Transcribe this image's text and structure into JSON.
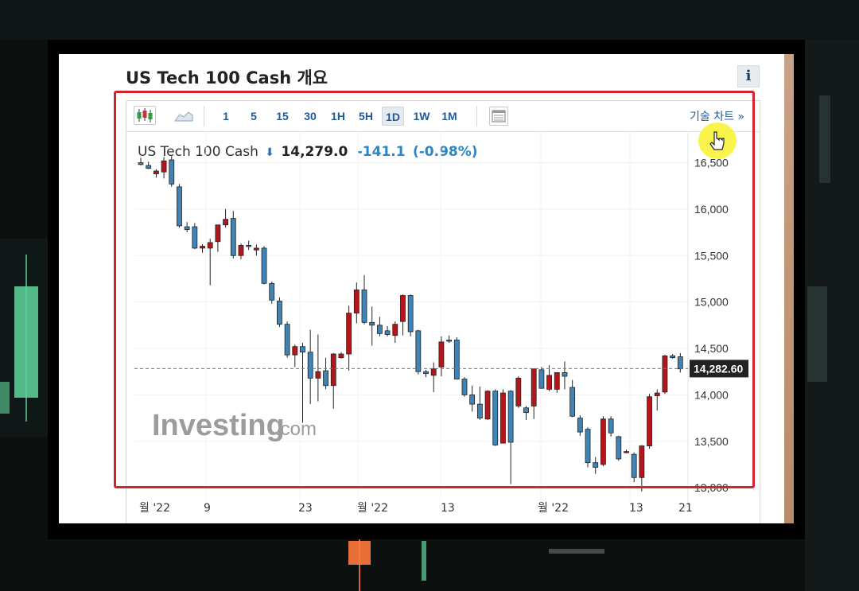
{
  "page": {
    "title": "US Tech 100 Cash 개요",
    "info_label": "i"
  },
  "toolbar": {
    "timeframes": [
      {
        "label": "1",
        "active": false
      },
      {
        "label": "5",
        "active": false
      },
      {
        "label": "15",
        "active": false
      },
      {
        "label": "30",
        "active": false
      },
      {
        "label": "1H",
        "active": false
      },
      {
        "label": "5H",
        "active": false
      },
      {
        "label": "1D",
        "active": true
      },
      {
        "label": "1W",
        "active": false
      },
      {
        "label": "1M",
        "active": false
      }
    ],
    "tech_chart_link": "기술 차트 »",
    "icons": [
      "candlestick-chart-icon",
      "area-chart-icon",
      "table-view-icon"
    ]
  },
  "quote": {
    "name": "US Tech 100 Cash",
    "direction_icon": "arrow-down-icon",
    "price": "14,279.0",
    "change": "-141.1",
    "change_pct": "(-0.98%)"
  },
  "watermark": {
    "brand": "Investing",
    "suffix": ".com"
  },
  "colors": {
    "up": "#b3171c",
    "down": "#3f84b7",
    "link": "#1f5b9a",
    "highlight_box": "#d3232b"
  },
  "chart_data": {
    "type": "candlestick",
    "ylim": [
      12950,
      16650
    ],
    "y_ticks": [
      "16,500",
      "16,000",
      "15,500",
      "15,000",
      "14,500",
      "14,000",
      "13,500",
      "13,000"
    ],
    "y_tick_values": [
      16500,
      16000,
      15500,
      15000,
      14500,
      14000,
      13500,
      13000
    ],
    "x_ticks": [
      "월 '22",
      "9",
      "23",
      "월 '22",
      "13",
      "월 '22",
      "13",
      "21"
    ],
    "last_price_label": "14,282.60",
    "last_price": 14282.6,
    "candles": [
      [
        16500,
        16550,
        16470,
        16480
      ],
      [
        16470,
        16510,
        16430,
        16440
      ],
      [
        16380,
        16430,
        16340,
        16410
      ],
      [
        16400,
        16560,
        16330,
        16520
      ],
      [
        16530,
        16570,
        16240,
        16270
      ],
      [
        16240,
        16270,
        15800,
        15820
      ],
      [
        15810,
        15860,
        15750,
        15780
      ],
      [
        15810,
        15850,
        15570,
        15580
      ],
      [
        15580,
        15620,
        15530,
        15600
      ],
      [
        15580,
        15680,
        15180,
        15640
      ],
      [
        15650,
        15830,
        15540,
        15830
      ],
      [
        15830,
        16000,
        15800,
        15890
      ],
      [
        15900,
        15980,
        15470,
        15500
      ],
      [
        15500,
        15630,
        15460,
        15610
      ],
      [
        15610,
        15660,
        15560,
        15600
      ],
      [
        15560,
        15620,
        15500,
        15580
      ],
      [
        15580,
        15600,
        15190,
        15200
      ],
      [
        15200,
        15220,
        14980,
        15020
      ],
      [
        15010,
        15050,
        14730,
        14760
      ],
      [
        14760,
        14790,
        14400,
        14430
      ],
      [
        14430,
        14540,
        14300,
        14520
      ],
      [
        14520,
        14560,
        13700,
        14460
      ],
      [
        14460,
        14700,
        13900,
        14180
      ],
      [
        14180,
        14650,
        13930,
        14250
      ],
      [
        14260,
        14400,
        14060,
        14100
      ],
      [
        14100,
        14450,
        13850,
        14440
      ],
      [
        14400,
        14460,
        14390,
        14440
      ],
      [
        14440,
        14960,
        14260,
        14880
      ],
      [
        14880,
        15210,
        14770,
        15130
      ],
      [
        15130,
        15290,
        14760,
        14780
      ],
      [
        14780,
        14950,
        14530,
        14750
      ],
      [
        14750,
        14840,
        14630,
        14660
      ],
      [
        14690,
        14740,
        14630,
        14650
      ],
      [
        14640,
        14790,
        14560,
        14760
      ],
      [
        14790,
        15080,
        14640,
        15070
      ],
      [
        15070,
        15080,
        14630,
        14680
      ],
      [
        14690,
        14700,
        14220,
        14250
      ],
      [
        14250,
        14270,
        14190,
        14230
      ],
      [
        14210,
        14350,
        14030,
        14280
      ],
      [
        14300,
        14630,
        14200,
        14570
      ],
      [
        14590,
        14640,
        14560,
        14580
      ],
      [
        14590,
        14620,
        14170,
        14170
      ],
      [
        14170,
        14190,
        13980,
        14000
      ],
      [
        14000,
        14100,
        13820,
        13900
      ],
      [
        13900,
        14090,
        13730,
        13750
      ],
      [
        13740,
        14050,
        13730,
        14040
      ],
      [
        14040,
        14060,
        13450,
        13460
      ],
      [
        13480,
        14060,
        13480,
        14020
      ],
      [
        14040,
        14050,
        13040,
        13490
      ],
      [
        13880,
        14200,
        13860,
        14180
      ],
      [
        13860,
        13880,
        13730,
        13810
      ],
      [
        13880,
        14270,
        13740,
        14280
      ],
      [
        14270,
        14300,
        14070,
        14070
      ],
      [
        14060,
        14320,
        14040,
        14210
      ],
      [
        14060,
        14240,
        14020,
        14240
      ],
      [
        14240,
        14360,
        14060,
        14200
      ],
      [
        14080,
        14160,
        13760,
        13770
      ],
      [
        13750,
        13780,
        13560,
        13600
      ],
      [
        13630,
        13650,
        13220,
        13270
      ],
      [
        13270,
        13330,
        13150,
        13220
      ],
      [
        13250,
        13770,
        13230,
        13740
      ],
      [
        13740,
        13770,
        13550,
        13590
      ],
      [
        13550,
        13560,
        13290,
        13310
      ],
      [
        13380,
        13410,
        13370,
        13390
      ],
      [
        13360,
        13380,
        13060,
        13110
      ],
      [
        13110,
        13460,
        12960,
        13450
      ],
      [
        13450,
        14010,
        13420,
        13980
      ],
      [
        13990,
        14060,
        13830,
        14020
      ],
      [
        14030,
        14430,
        14010,
        14420
      ],
      [
        14420,
        14440,
        14390,
        14400
      ],
      [
        14410,
        14450,
        14240,
        14280
      ]
    ]
  }
}
